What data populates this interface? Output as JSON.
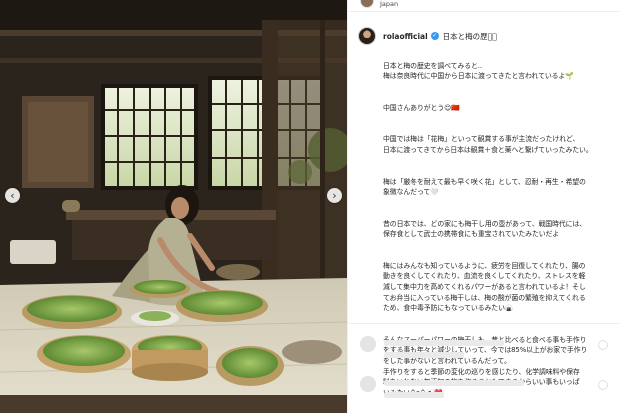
{
  "photo": {
    "image": "woman-sorting-plums-in-traditional-japanese-house",
    "prev_icon": "chevron-left-icon",
    "next_icon": "chevron-right-icon",
    "prev_glyph": "‹",
    "next_glyph": "›"
  },
  "post": {
    "location": "Japan",
    "username": "rolaofficial",
    "verified_glyph": "✓",
    "title": "日本と梅の歴史🏻",
    "paragraphs": [
      "日本と梅の歴史を調べてみると..\n梅は奈良時代に中国から日本に渡ってきたと言われているよ🌱",
      "中国さんありがとう😊🇨🇳",
      "中国では梅は「花梅」といって観賞する事が主流だったけれど、\n日本に渡ってきてから日本は観賞＋食と薬へと繋げていったみたい。",
      "梅は「厳冬を耐えて最も早く咲く花」として、忍耐・再生・希望の\n象徴なんだって🤍",
      "昔の日本では、どの家にも梅干し用の壺があって、戦国時代には、\n保存食として武士の携帯食にも重宝されていたみたいだよ",
      "梅にはみんなも知っているように、疲労を回復してくれたり、腸の\n動きを良くしてくれたり、血流を良くしてくれたり、ストレスを軽\n減して集中力を高めてくれるパワーがあると言われているよ！そし\nてお弁当に入っている梅干しは、梅の酸が菌の繁殖を抑えてくれる\nため、食中毒予防にもなっているみたい🍙",
      "そんなスーパーパワーの梅干しも、昔と比べると食べる事も手作り\nをする事も年々と減少していって、今では85%以上がお家で手作り\nをした事がないと言われているんだって。\n手作りをすると季節の変化の巡りを感じたり、化学調味料や保存\n料をいれない無添加の梅を作ることもできるからいい事もいっぱ\nいみたい^o^🇯🇵❤️"
    ]
  },
  "colors": {
    "verified": "#3897f0",
    "text": "#262626",
    "divider": "#efefef"
  }
}
